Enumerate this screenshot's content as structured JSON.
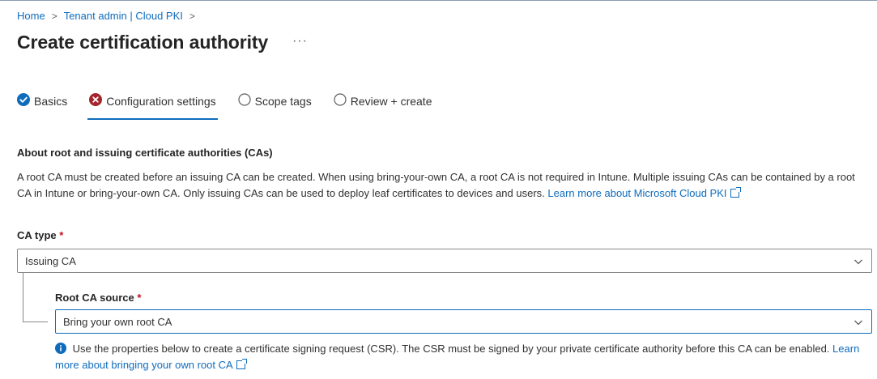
{
  "breadcrumb": {
    "items": [
      "Home",
      "Tenant admin | Cloud PKI"
    ],
    "separator": ">"
  },
  "page": {
    "title": "Create certification authority",
    "more_label": "···"
  },
  "tabs": [
    {
      "label": "Basics",
      "status": "complete",
      "icon": "checkmark-circle-icon"
    },
    {
      "label": "Configuration settings",
      "status": "error",
      "icon": "error-circle-icon",
      "active": true
    },
    {
      "label": "Scope tags",
      "status": "pending",
      "icon": "empty-circle-icon"
    },
    {
      "label": "Review + create",
      "status": "pending",
      "icon": "empty-circle-icon"
    }
  ],
  "section": {
    "heading": "About root and issuing certificate authorities (CAs)",
    "description": "A root CA must be created before an issuing CA can be created. When using bring-your-own CA, a root CA is not required in Intune. Multiple issuing CAs can be contained by a root CA in Intune or bring-your-own CA. Only issuing CAs can be used to deploy leaf certificates to devices and users.",
    "learn_more_link": "Learn more about Microsoft Cloud PKI"
  },
  "ca_type": {
    "label": "CA type",
    "required_mark": "*",
    "value": "Issuing CA"
  },
  "root_ca_source": {
    "label": "Root CA source",
    "required_mark": "*",
    "value": "Bring your own root CA"
  },
  "info_message": {
    "text": "Use the properties below to create a certificate signing request (CSR). The CSR must be signed by your private certificate authority before this CA can be enabled.",
    "link": "Learn more about bringing your own root CA"
  },
  "colors": {
    "accent": "#0f6cbd",
    "error": "#c50f1f",
    "text": "#323130"
  }
}
